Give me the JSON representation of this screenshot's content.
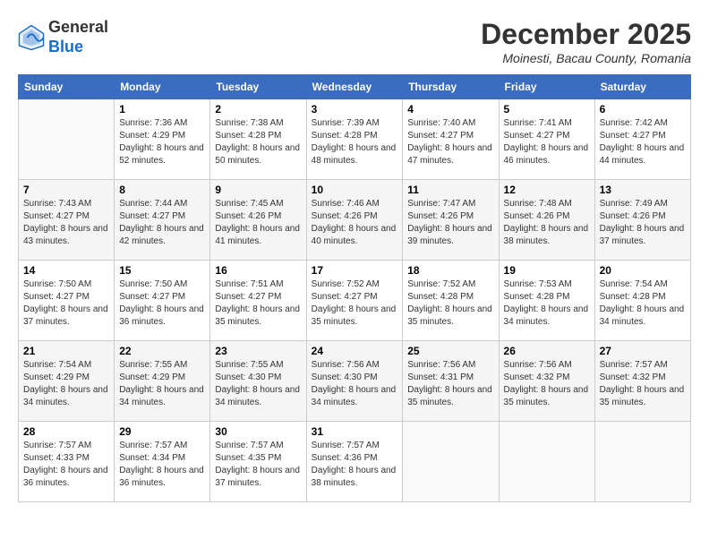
{
  "logo": {
    "general": "General",
    "blue": "Blue"
  },
  "title": "December 2025",
  "location": "Moinesti, Bacau County, Romania",
  "weekdays": [
    "Sunday",
    "Monday",
    "Tuesday",
    "Wednesday",
    "Thursday",
    "Friday",
    "Saturday"
  ],
  "weeks": [
    [
      {
        "day": "",
        "sunrise": "",
        "sunset": "",
        "daylight": ""
      },
      {
        "day": "1",
        "sunrise": "Sunrise: 7:36 AM",
        "sunset": "Sunset: 4:29 PM",
        "daylight": "Daylight: 8 hours and 52 minutes."
      },
      {
        "day": "2",
        "sunrise": "Sunrise: 7:38 AM",
        "sunset": "Sunset: 4:28 PM",
        "daylight": "Daylight: 8 hours and 50 minutes."
      },
      {
        "day": "3",
        "sunrise": "Sunrise: 7:39 AM",
        "sunset": "Sunset: 4:28 PM",
        "daylight": "Daylight: 8 hours and 48 minutes."
      },
      {
        "day": "4",
        "sunrise": "Sunrise: 7:40 AM",
        "sunset": "Sunset: 4:27 PM",
        "daylight": "Daylight: 8 hours and 47 minutes."
      },
      {
        "day": "5",
        "sunrise": "Sunrise: 7:41 AM",
        "sunset": "Sunset: 4:27 PM",
        "daylight": "Daylight: 8 hours and 46 minutes."
      },
      {
        "day": "6",
        "sunrise": "Sunrise: 7:42 AM",
        "sunset": "Sunset: 4:27 PM",
        "daylight": "Daylight: 8 hours and 44 minutes."
      }
    ],
    [
      {
        "day": "7",
        "sunrise": "Sunrise: 7:43 AM",
        "sunset": "Sunset: 4:27 PM",
        "daylight": "Daylight: 8 hours and 43 minutes."
      },
      {
        "day": "8",
        "sunrise": "Sunrise: 7:44 AM",
        "sunset": "Sunset: 4:27 PM",
        "daylight": "Daylight: 8 hours and 42 minutes."
      },
      {
        "day": "9",
        "sunrise": "Sunrise: 7:45 AM",
        "sunset": "Sunset: 4:26 PM",
        "daylight": "Daylight: 8 hours and 41 minutes."
      },
      {
        "day": "10",
        "sunrise": "Sunrise: 7:46 AM",
        "sunset": "Sunset: 4:26 PM",
        "daylight": "Daylight: 8 hours and 40 minutes."
      },
      {
        "day": "11",
        "sunrise": "Sunrise: 7:47 AM",
        "sunset": "Sunset: 4:26 PM",
        "daylight": "Daylight: 8 hours and 39 minutes."
      },
      {
        "day": "12",
        "sunrise": "Sunrise: 7:48 AM",
        "sunset": "Sunset: 4:26 PM",
        "daylight": "Daylight: 8 hours and 38 minutes."
      },
      {
        "day": "13",
        "sunrise": "Sunrise: 7:49 AM",
        "sunset": "Sunset: 4:26 PM",
        "daylight": "Daylight: 8 hours and 37 minutes."
      }
    ],
    [
      {
        "day": "14",
        "sunrise": "Sunrise: 7:50 AM",
        "sunset": "Sunset: 4:27 PM",
        "daylight": "Daylight: 8 hours and 37 minutes."
      },
      {
        "day": "15",
        "sunrise": "Sunrise: 7:50 AM",
        "sunset": "Sunset: 4:27 PM",
        "daylight": "Daylight: 8 hours and 36 minutes."
      },
      {
        "day": "16",
        "sunrise": "Sunrise: 7:51 AM",
        "sunset": "Sunset: 4:27 PM",
        "daylight": "Daylight: 8 hours and 35 minutes."
      },
      {
        "day": "17",
        "sunrise": "Sunrise: 7:52 AM",
        "sunset": "Sunset: 4:27 PM",
        "daylight": "Daylight: 8 hours and 35 minutes."
      },
      {
        "day": "18",
        "sunrise": "Sunrise: 7:52 AM",
        "sunset": "Sunset: 4:28 PM",
        "daylight": "Daylight: 8 hours and 35 minutes."
      },
      {
        "day": "19",
        "sunrise": "Sunrise: 7:53 AM",
        "sunset": "Sunset: 4:28 PM",
        "daylight": "Daylight: 8 hours and 34 minutes."
      },
      {
        "day": "20",
        "sunrise": "Sunrise: 7:54 AM",
        "sunset": "Sunset: 4:28 PM",
        "daylight": "Daylight: 8 hours and 34 minutes."
      }
    ],
    [
      {
        "day": "21",
        "sunrise": "Sunrise: 7:54 AM",
        "sunset": "Sunset: 4:29 PM",
        "daylight": "Daylight: 8 hours and 34 minutes."
      },
      {
        "day": "22",
        "sunrise": "Sunrise: 7:55 AM",
        "sunset": "Sunset: 4:29 PM",
        "daylight": "Daylight: 8 hours and 34 minutes."
      },
      {
        "day": "23",
        "sunrise": "Sunrise: 7:55 AM",
        "sunset": "Sunset: 4:30 PM",
        "daylight": "Daylight: 8 hours and 34 minutes."
      },
      {
        "day": "24",
        "sunrise": "Sunrise: 7:56 AM",
        "sunset": "Sunset: 4:30 PM",
        "daylight": "Daylight: 8 hours and 34 minutes."
      },
      {
        "day": "25",
        "sunrise": "Sunrise: 7:56 AM",
        "sunset": "Sunset: 4:31 PM",
        "daylight": "Daylight: 8 hours and 35 minutes."
      },
      {
        "day": "26",
        "sunrise": "Sunrise: 7:56 AM",
        "sunset": "Sunset: 4:32 PM",
        "daylight": "Daylight: 8 hours and 35 minutes."
      },
      {
        "day": "27",
        "sunrise": "Sunrise: 7:57 AM",
        "sunset": "Sunset: 4:32 PM",
        "daylight": "Daylight: 8 hours and 35 minutes."
      }
    ],
    [
      {
        "day": "28",
        "sunrise": "Sunrise: 7:57 AM",
        "sunset": "Sunset: 4:33 PM",
        "daylight": "Daylight: 8 hours and 36 minutes."
      },
      {
        "day": "29",
        "sunrise": "Sunrise: 7:57 AM",
        "sunset": "Sunset: 4:34 PM",
        "daylight": "Daylight: 8 hours and 36 minutes."
      },
      {
        "day": "30",
        "sunrise": "Sunrise: 7:57 AM",
        "sunset": "Sunset: 4:35 PM",
        "daylight": "Daylight: 8 hours and 37 minutes."
      },
      {
        "day": "31",
        "sunrise": "Sunrise: 7:57 AM",
        "sunset": "Sunset: 4:36 PM",
        "daylight": "Daylight: 8 hours and 38 minutes."
      },
      {
        "day": "",
        "sunrise": "",
        "sunset": "",
        "daylight": ""
      },
      {
        "day": "",
        "sunrise": "",
        "sunset": "",
        "daylight": ""
      },
      {
        "day": "",
        "sunrise": "",
        "sunset": "",
        "daylight": ""
      }
    ]
  ]
}
